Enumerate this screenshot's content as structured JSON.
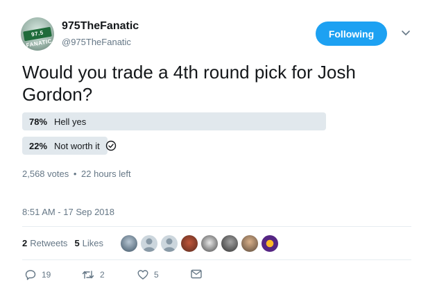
{
  "user": {
    "display_name": "975TheFanatic",
    "handle": "@975TheFanatic",
    "avatar_text": "97.5 FANATIC"
  },
  "follow_button": {
    "label": "Following"
  },
  "tweet": {
    "text": "Would you trade a 4th round pick for Josh Gordon?"
  },
  "poll": {
    "options": [
      {
        "percent": "78%",
        "label": "Hell yes",
        "fraction": 0.78
      },
      {
        "percent": "22%",
        "label": "Not worth it",
        "fraction": 0.22,
        "selected": true
      }
    ],
    "votes": "2,568 votes",
    "separator": "•",
    "time_left": "22 hours left"
  },
  "timestamp": "8:51 AM - 17 Sep 2018",
  "engagement": {
    "retweets_count": "2",
    "retweets_label": "Retweets",
    "likes_count": "5",
    "likes_label": "Likes"
  },
  "actions": {
    "reply_count": "19",
    "retweet_count": "2",
    "like_count": "5"
  },
  "colors": {
    "accent": "#1da1f2",
    "poll_bar": "#e1e8ed",
    "muted_text": "#657786",
    "primary_text": "#14171a"
  }
}
